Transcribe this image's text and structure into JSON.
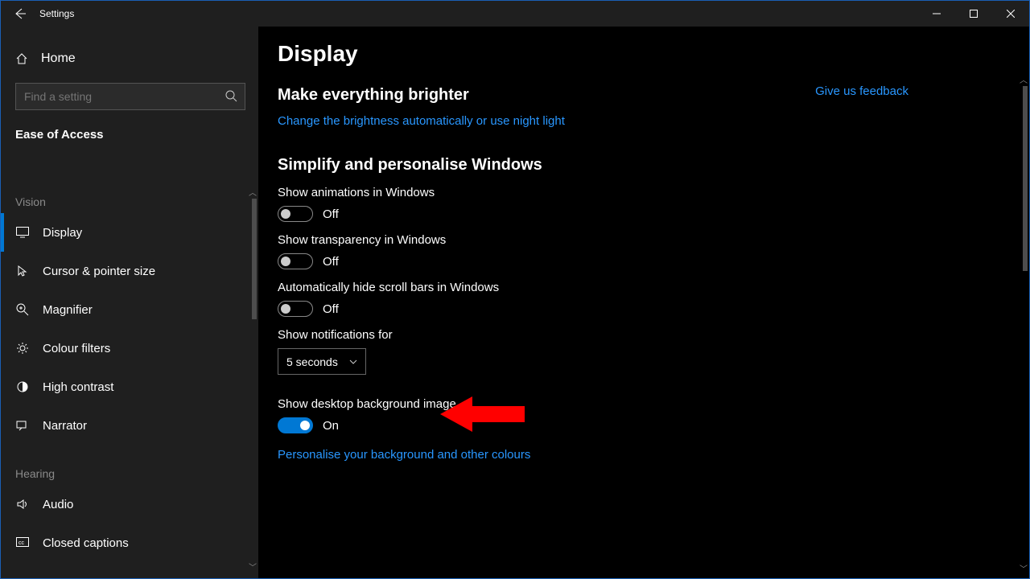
{
  "titlebar": {
    "title": "Settings"
  },
  "sidebar": {
    "home": "Home",
    "search_placeholder": "Find a setting",
    "category": "Ease of Access",
    "groups": [
      {
        "label": "Vision",
        "items": [
          {
            "key": "display",
            "label": "Display",
            "selected": true
          },
          {
            "key": "cursor",
            "label": "Cursor & pointer size"
          },
          {
            "key": "magnifier",
            "label": "Magnifier"
          },
          {
            "key": "colour-filters",
            "label": "Colour filters"
          },
          {
            "key": "high-contrast",
            "label": "High contrast"
          },
          {
            "key": "narrator",
            "label": "Narrator"
          }
        ]
      },
      {
        "label": "Hearing",
        "items": [
          {
            "key": "audio",
            "label": "Audio"
          },
          {
            "key": "closed-captions",
            "label": "Closed captions"
          }
        ]
      }
    ]
  },
  "main": {
    "title": "Display",
    "feedback": "Give us feedback",
    "brighter": {
      "heading": "Make everything brighter",
      "link": "Change the brightness automatically or use night light"
    },
    "simplify": {
      "heading": "Simplify and personalise Windows",
      "show_animations": {
        "label": "Show animations in Windows",
        "state": "Off"
      },
      "show_transparency": {
        "label": "Show transparency in Windows",
        "state": "Off"
      },
      "auto_hide_scroll": {
        "label": "Automatically hide scroll bars in Windows",
        "state": "Off"
      },
      "notifications": {
        "label": "Show notifications for",
        "value": "5 seconds"
      },
      "desktop_bg": {
        "label": "Show desktop background image",
        "state": "On"
      },
      "personalise_link": "Personalise your background and other colours"
    }
  }
}
